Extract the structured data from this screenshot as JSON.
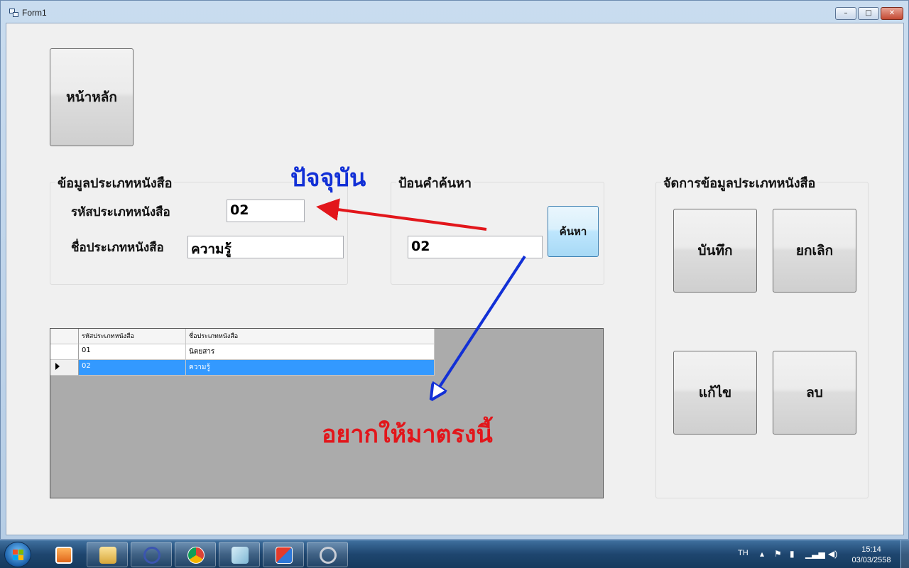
{
  "window": {
    "title": "Form1",
    "min_symbol": "–",
    "max_symbol": "□",
    "close_symbol": "✕"
  },
  "home_button": "หน้าหลัก",
  "book_type_group": {
    "title": "ข้อมูลประเภทหนังสือ",
    "code_label": "รหัสประเภทหนังสือ",
    "code_value": "02",
    "name_label": "ชื่อประเภทหนังสือ",
    "name_value": "ความรู้"
  },
  "search_group": {
    "title": "ป้อนคำค้นหา",
    "query_value": "02",
    "search_button": "ค้นหา"
  },
  "manage_group": {
    "title": "จัดการข้อมูลประเภทหนังสือ",
    "save_button": "บันทึก",
    "cancel_button": "ยกเลิก",
    "edit_button": "แก้ไข",
    "delete_button": "ลบ"
  },
  "grid": {
    "headers": [
      "รหัสประเภทหนังสือ",
      "ชื่อประเภทหนังสือ"
    ],
    "rows": [
      {
        "code": "01",
        "name": "นิตยสาร",
        "selected": false
      },
      {
        "code": "02",
        "name": "ความรู้",
        "selected": true
      }
    ]
  },
  "annotations": {
    "current": "ปัจจุบัน",
    "want_here": "อยากให้มาตรงนี้",
    "red_arrow_color": "#e2161b",
    "blue_arrow_color": "#1230d6"
  },
  "taskbar": {
    "language": "TH",
    "time": "15:14",
    "date": "03/03/2558"
  }
}
